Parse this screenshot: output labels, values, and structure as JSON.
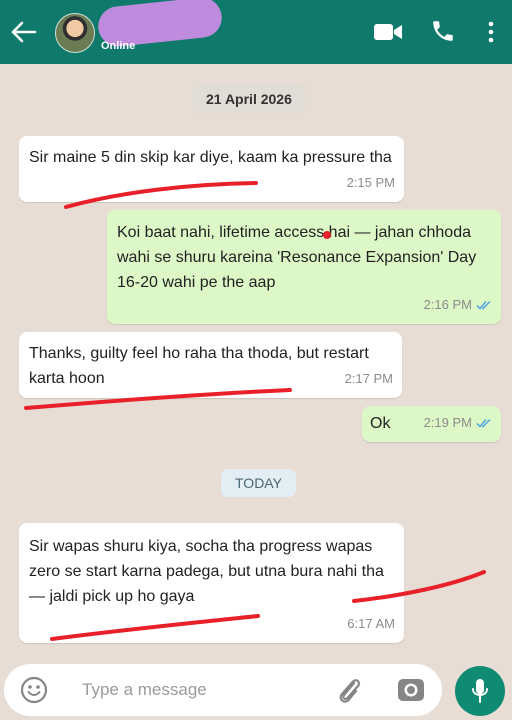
{
  "header": {
    "status": "Online"
  },
  "chat": {
    "date_first": "21 April 2026",
    "date_today": "TODAY",
    "messages": [
      {
        "direction": "in",
        "text": "Sir maine 5 din skip kar diye, kaam ka pressure tha",
        "time": "2:15 PM"
      },
      {
        "direction": "out",
        "text": "Koi baat nahi, lifetime access hai — jahan chhoda wahi se shuru kareina 'Resonance Expansion' Day 16-20 wahi pe the aap",
        "time": "2:16 PM",
        "read": true
      },
      {
        "direction": "in",
        "text": "Thanks, guilty feel ho raha tha thoda, but restart karta hoon",
        "time": "2:17 PM"
      },
      {
        "direction": "out",
        "text": "Ok",
        "time": "2:19 PM",
        "read": true
      },
      {
        "direction": "in",
        "text": "Sir wapas shuru kiya, socha tha progress wapas zero se start karna padega, but utna bura nahi tha — jaldi pick up ho gaya",
        "time": "6:17 AM"
      }
    ]
  },
  "input": {
    "placeholder": "Type a message"
  },
  "colors": {
    "header": "#0f7a6b",
    "incoming_bubble": "#ffffff",
    "outgoing_bubble": "#dcf8c6",
    "read_tick": "#4fa3e0",
    "annotation_red": "#e8202a",
    "mic_button": "#0f8a73"
  },
  "icons": [
    "back-arrow-icon",
    "video-call-icon",
    "phone-icon",
    "more-options-icon",
    "emoji-icon",
    "attach-icon",
    "camera-icon",
    "mic-icon"
  ]
}
